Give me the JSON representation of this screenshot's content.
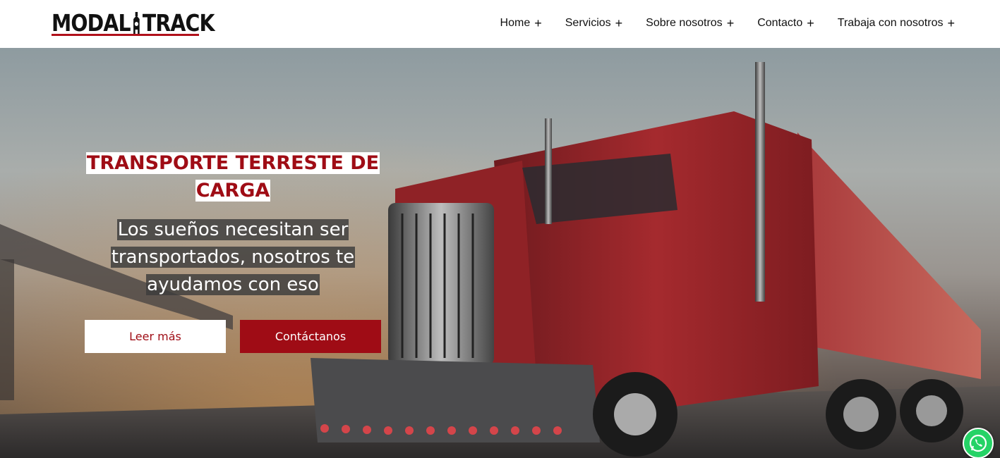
{
  "header": {
    "logo_text_left": "MODAL",
    "logo_text_right": "TRACK",
    "nav": [
      {
        "label": "Home",
        "icon": "plus"
      },
      {
        "label": "Servicios",
        "icon": "plus"
      },
      {
        "label": "Sobre nosotros",
        "icon": "plus"
      },
      {
        "label": "Contacto",
        "icon": "plus"
      },
      {
        "label": "Trabaja con nosotros",
        "icon": "plus"
      }
    ]
  },
  "hero": {
    "title_line1": "TRANSPORTE TERRESTE DE",
    "title_line2": "CARGA",
    "subtitle_line1": "Los sueños necesitan ser",
    "subtitle_line2": "transportados, nosotros te",
    "subtitle_line3": "ayudamos con eso",
    "read_more_label": "Leer más",
    "contact_label": "Contáctanos",
    "background_icon": "red-semi-truck-image"
  },
  "floating": {
    "whatsapp_icon": "whatsapp-icon"
  },
  "colors": {
    "brand_red": "#9f0c15",
    "whatsapp_green": "#25d366"
  }
}
